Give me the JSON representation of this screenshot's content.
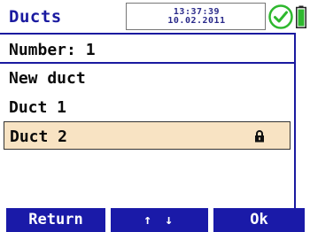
{
  "header": {
    "title": "Ducts",
    "time": "13:37:39",
    "date": "10.02.2011",
    "status_icon": "check-circle-icon",
    "battery_icon": "battery-icon",
    "accent_color": "#1a1aa0",
    "status_color": "#2eb82e"
  },
  "subheader": {
    "text": "Number: 1"
  },
  "list": {
    "items": [
      {
        "label": "New duct",
        "selected": false,
        "locked": false
      },
      {
        "label": "Duct 1",
        "selected": false,
        "locked": false
      },
      {
        "label": "Duct 2",
        "selected": true,
        "locked": true
      }
    ],
    "selected_color": "#f8e3c3"
  },
  "softkeys": {
    "return_label": "Return",
    "nav_label": "↑ ↓",
    "ok_label": "Ok"
  }
}
